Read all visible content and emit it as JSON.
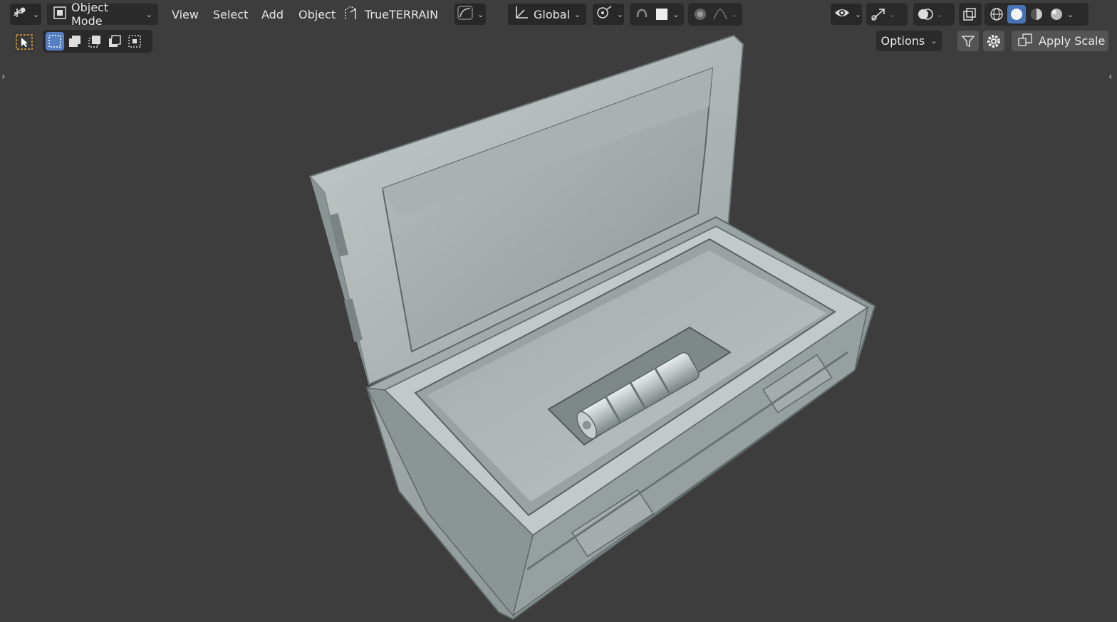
{
  "header": {
    "mode_label": "Object Mode",
    "menus": [
      "View",
      "Select",
      "Add",
      "Object"
    ],
    "addon_label": "TrueTERRAIN",
    "orientation_label": "Global"
  },
  "tool_settings": {
    "options_label": "Options",
    "apply_scale_label": "Apply Scale"
  },
  "icons": {
    "editor_type": "editor-type-icon",
    "object_mode": "object-mode-icon",
    "select_box": "select-box-icon",
    "snap": "snap-icon",
    "proportional": "proportional-edit-icon",
    "visibility": "eye-icon",
    "gizmo": "gizmo-icon",
    "overlay": "overlay-icon",
    "xray": "xray-icon",
    "shading_wire": "wireframe-shading-icon",
    "shading_solid": "solid-shading-icon",
    "shading_material": "material-shading-icon",
    "shading_render": "render-shading-icon"
  },
  "colors": {
    "viewport_bg": "#3d3d3d",
    "active_blue": "#4772b3",
    "model": "#a8b0b0"
  }
}
